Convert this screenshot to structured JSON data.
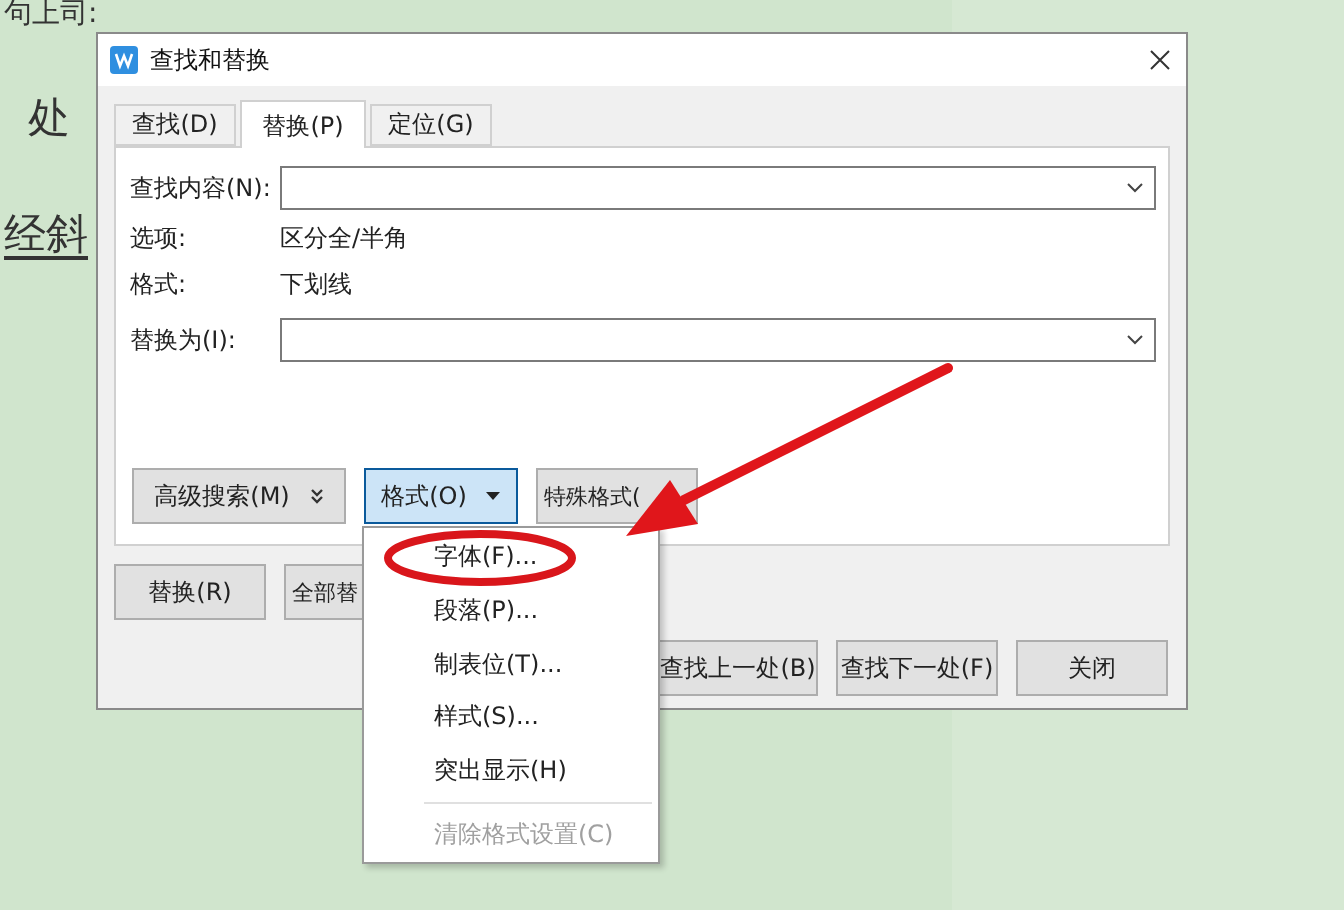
{
  "document": {
    "lines": [
      {
        "text": "句上司:",
        "underlined": false
      },
      {
        "text": "处",
        "underlined": false
      },
      {
        "text": "经斜",
        "underlined": true
      }
    ]
  },
  "dialog": {
    "title": "查找和替换",
    "tabs": [
      {
        "label": "查找(D)",
        "selected": false
      },
      {
        "label": "替换(P)",
        "selected": true
      },
      {
        "label": "定位(G)",
        "selected": false
      }
    ],
    "find_field": {
      "label": "查找内容(N):"
    },
    "info": [
      {
        "label": "选项:",
        "value": "区分全/半角"
      },
      {
        "label": "格式:",
        "value": "下划线"
      }
    ],
    "replace_field": {
      "label": "替换为(I):"
    },
    "option_buttons": [
      {
        "label": "高级搜索(M)",
        "kind": "expander",
        "selected": false
      },
      {
        "label": "格式(O)",
        "kind": "dropdown",
        "selected": true
      },
      {
        "label": "特殊格式(",
        "kind": "plain",
        "selected": false
      }
    ],
    "action_buttons": [
      "替换(R)",
      "全部替"
    ],
    "nav_buttons": [
      "查找上一处(B)",
      "查找下一处(F)",
      "关闭"
    ]
  },
  "menu": {
    "items": [
      {
        "label": "字体(F)...",
        "disabled": false,
        "separator_before": false
      },
      {
        "label": "段落(P)...",
        "disabled": false,
        "separator_before": false
      },
      {
        "label": "制表位(T)...",
        "disabled": false,
        "separator_before": false
      },
      {
        "label": "样式(S)...",
        "disabled": false,
        "separator_before": false
      },
      {
        "label": "突出显示(H)",
        "disabled": false,
        "separator_before": false
      },
      {
        "label": "清除格式设置(C)",
        "disabled": true,
        "separator_before": true
      }
    ]
  }
}
